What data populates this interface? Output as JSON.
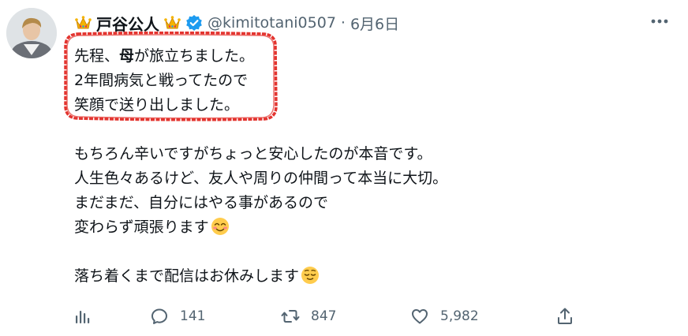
{
  "author": {
    "display_name": "戸谷公人",
    "handle": "@kimitotani0507",
    "separator": "·",
    "date": "6月6日",
    "verified": true,
    "name_decoration": "crown-emoji"
  },
  "tweet": {
    "lines": [
      {
        "pre": "先程、",
        "bold": "母",
        "post": "が旅立ちました。"
      },
      "2年間病気と戦ってたので",
      "笑顔で送り出しました。",
      "",
      "もちろん辛いですがちょっと安心したのが本音です。",
      "人生色々あるけど、友人や周りの仲間って本当に大切。",
      "まだまだ、自分にはやる事があるので",
      "変わらず頑張ります",
      "",
      "落ち着くまで配信はお休みします"
    ],
    "emojis": {
      "line8": "smiling-face-emoji",
      "line10": "relieved-face-emoji"
    },
    "highlight_color": "#e3342f"
  },
  "actions": {
    "views_icon": "bar-chart-icon",
    "replies": "141",
    "retweets": "847",
    "likes": "5,982",
    "share_icon": "share-icon",
    "more_icon": "more-dots-icon"
  },
  "colors": {
    "text": "#0f1419",
    "secondary": "#536471",
    "verified_badge": "#1d9bf0"
  }
}
